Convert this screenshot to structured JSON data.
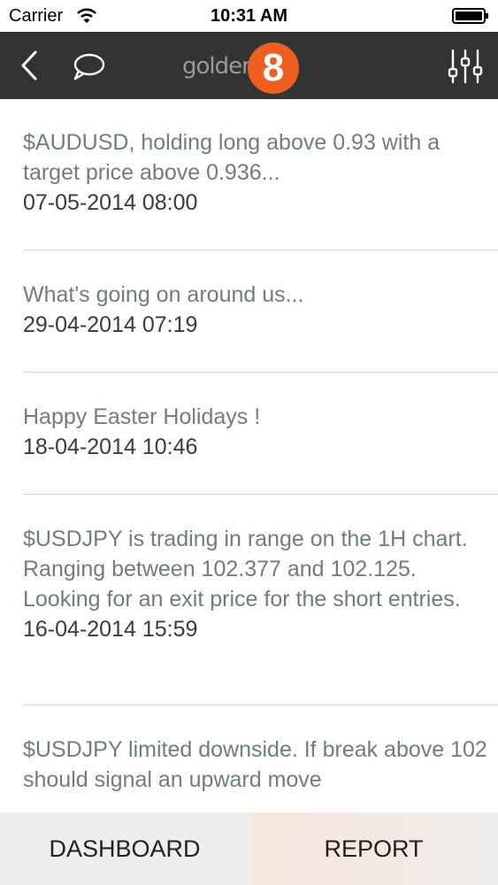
{
  "status_bar": {
    "carrier": "Carrier",
    "time": "10:31 AM"
  },
  "nav": {
    "logo_text": "golden",
    "logo_number": "8",
    "back_icon": "chevron-left-icon",
    "chat_icon": "speech-bubble-icon",
    "settings_icon": "equalizer-sliders-icon"
  },
  "messages": [
    {
      "text": "$AUDUSD, holding long above 0.93 with a target price above 0.936...",
      "date": "07-05-2014 08:00"
    },
    {
      "text": "What's going on around us...",
      "date": "29-04-2014 07:19"
    },
    {
      "text": "Happy Easter Holidays !",
      "date": "18-04-2014 10:46"
    },
    {
      "text": "$USDJPY is trading in range on the 1H chart. Ranging between 102.377 and 102.125. Looking for an exit price for the short entries.",
      "date": "16-04-2014 15:59"
    },
    {
      "text": "$USDJPY limited downside. If break above 102 should signal an upward move",
      "date": ""
    }
  ],
  "tabs": {
    "dashboard": "DASHBOARD",
    "report": "REPORT"
  },
  "colors": {
    "navbar": "#333333",
    "accent": "#ee5f1e",
    "message_text": "#6f7f78",
    "date_text": "#3b3b3b"
  }
}
